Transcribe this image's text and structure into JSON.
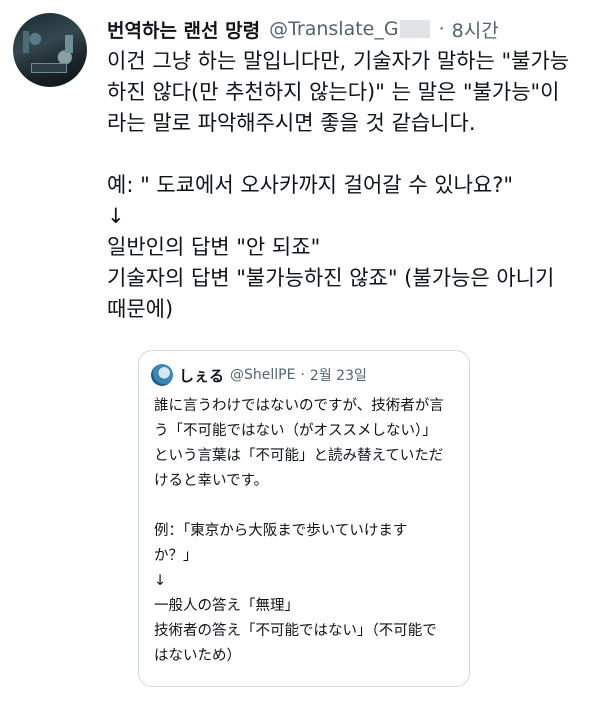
{
  "author": {
    "display_name": "번역하는 랜선 망령",
    "handle": "@Translate_G",
    "separator": "·",
    "time": "8시간"
  },
  "tweet": {
    "lines": [
      "이건 그냥 하는 말입니다만, 기술자가 말하는 \"불가능",
      "하진 않다(만 추천하지 않는다)\" 는 말은 \"불가능\"이",
      "라는 말로 파악해주시면 좋을 것 같습니다.",
      "",
      "예: \" 도쿄에서 오사카까지 걸어갈 수 있나요?\"",
      "↓",
      "일반인의 답변 \"안 되죠\"",
      "기술자의 답변 \"불가능하진 않죠\" (불가능은 아니기",
      "때문에)"
    ]
  },
  "quoted_tweet": {
    "display_name": "しぇる",
    "handle": "@ShellPE",
    "separator": "·",
    "date": "2월 23일",
    "lines": [
      "誰に言うわけではないのですが、技術者が言",
      "う「不可能ではない（がオススメしない）」",
      "という言葉は「不可能」と読み替えていただ",
      "けると幸いです。",
      "",
      "例：「東京から大阪まで歩いていけます",
      "か？」",
      "↓",
      "一般人の答え「無理」",
      "技術者の答え「不可能ではない」（不可能で",
      "はないため）"
    ]
  }
}
